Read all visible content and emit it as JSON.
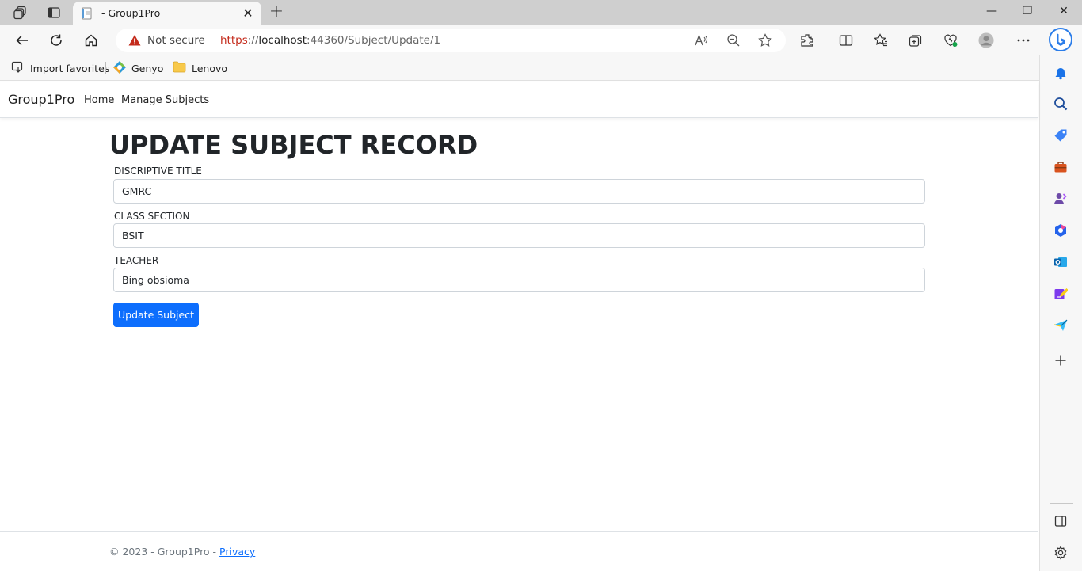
{
  "browser": {
    "tab_title": "- Group1Pro",
    "tab_close": "✕",
    "new_tab": "+",
    "win_min": "—",
    "win_restore": "❐",
    "win_close": "✕",
    "security_label": "Not secure",
    "url_scheme": "https",
    "url_sep": "://",
    "url_host": "localhost",
    "url_rest": ":44360/Subject/Update/1",
    "favorites": [
      {
        "label": "Import favorites",
        "icon": "import-icon"
      },
      {
        "label": "Genyo",
        "icon": "genyo-logo-icon"
      },
      {
        "label": "Lenovo",
        "icon": "folder-icon"
      }
    ],
    "colors": {
      "warning": "#c42b1c",
      "accent": "#0d6efd"
    }
  },
  "navbar": {
    "brand": "Group1Pro",
    "links": [
      "Home",
      "Manage Subjects"
    ]
  },
  "form": {
    "heading": "UPDATE SUBJECT RECORD",
    "fields": [
      {
        "label": "DISCRIPTIVE TITLE",
        "value": "GMRC"
      },
      {
        "label": "CLASS SECTION",
        "value": "BSIT"
      },
      {
        "label": "TEACHER",
        "value": "Bing obsioma"
      }
    ],
    "submit_label": "Update Subject"
  },
  "footer": {
    "text": "© 2023 - Group1Pro - ",
    "privacy_link": "Privacy"
  }
}
